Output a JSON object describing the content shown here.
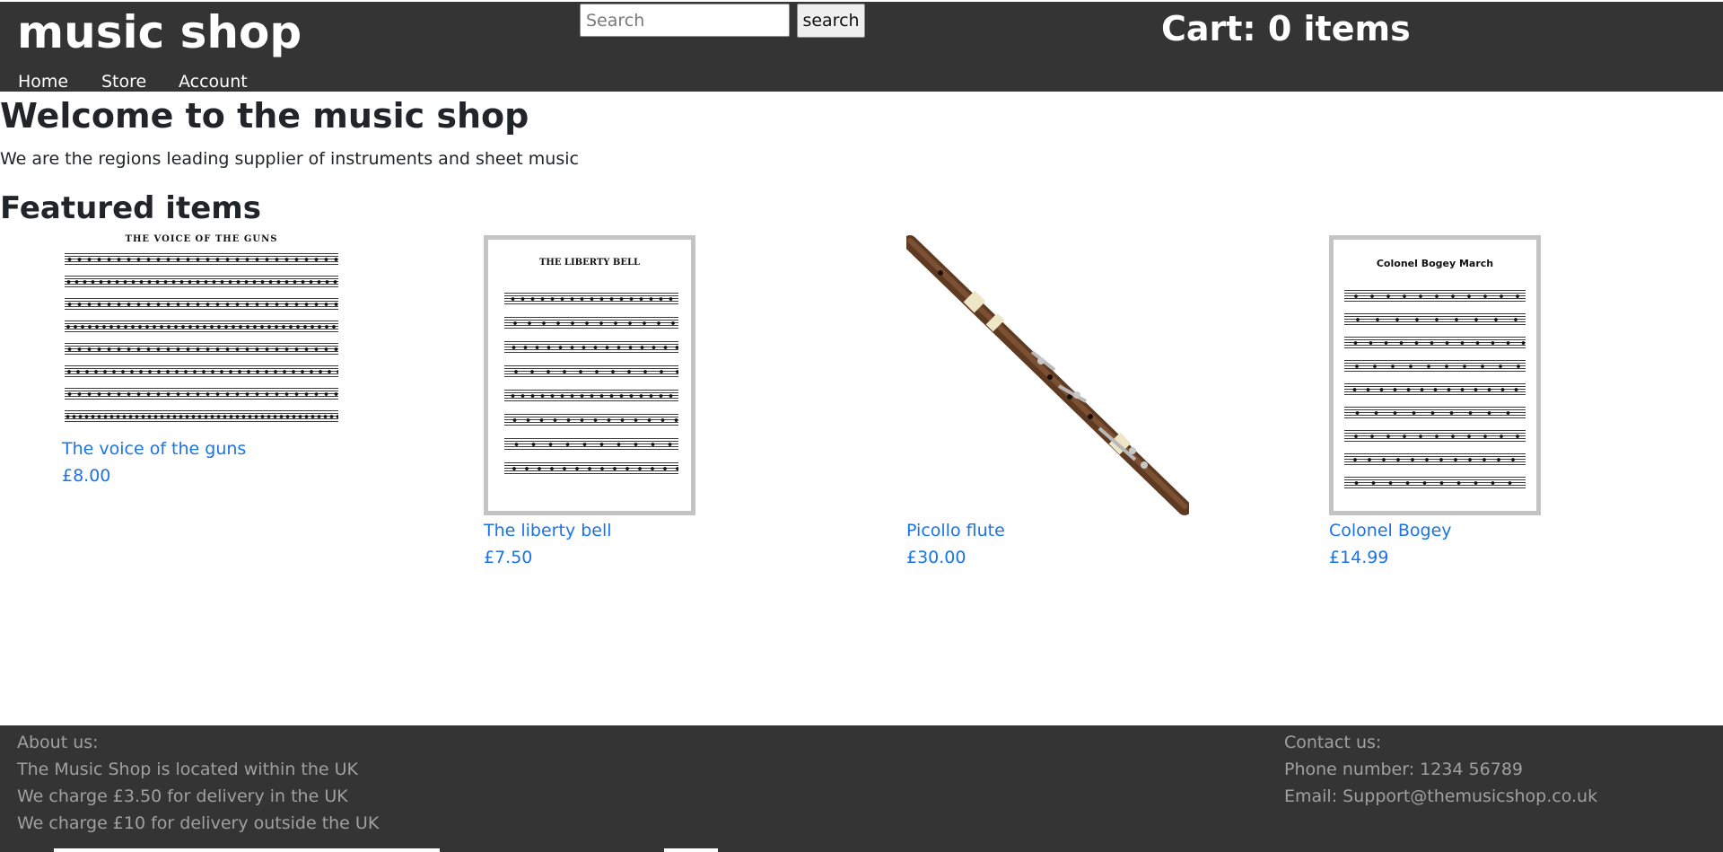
{
  "header": {
    "logo": "music shop",
    "search": {
      "placeholder": "Search",
      "value": "",
      "button_label": "search"
    },
    "cart_label": "Cart: 0 items",
    "nav": [
      "Home",
      "Store",
      "Account"
    ]
  },
  "main": {
    "welcome_title": "Welcome to the music shop",
    "intro_text": "We are the regions leading supplier of instruments and sheet music",
    "featured_title": "Featured items",
    "products": [
      {
        "name": "The voice of the guns",
        "price": "£8.00",
        "image": "sheet-music-image",
        "image_title": "THE VOICE OF THE GUNS"
      },
      {
        "name": "The liberty bell",
        "price": "£7.50",
        "image": "sheet-music-image",
        "image_title": "THE LIBERTY BELL"
      },
      {
        "name": "Picollo flute",
        "price": "£30.00",
        "image": "flute-image"
      },
      {
        "name": "Colonel Bogey",
        "price": "£14.99",
        "image": "sheet-music-image",
        "image_title": "Colonel Bogey March"
      }
    ]
  },
  "footer": {
    "about": {
      "heading": "About us:",
      "lines": [
        "The Music Shop is located within the UK",
        "We charge £3.50 for delivery in the UK",
        "We charge £10 for delivery outside the UK"
      ]
    },
    "contact": {
      "heading": "Contact us:",
      "lines": [
        "Phone number: 1234 56789",
        "Email: Support@themusicshop.co.uk"
      ]
    }
  },
  "colors": {
    "header_bg": "#343434",
    "link": "#1a73e8",
    "footer_text": "#a0a0a0"
  }
}
